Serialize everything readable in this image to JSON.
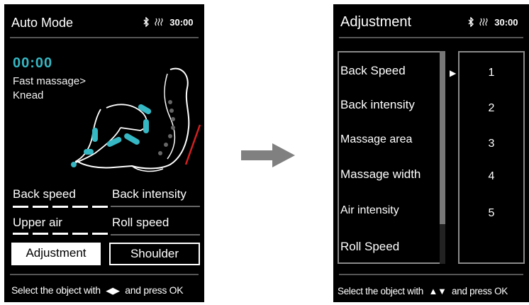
{
  "left_screen": {
    "title": "Auto Mode",
    "status": {
      "bluetooth_icon": "bluetooth-icon",
      "heat_icon": "heat-wave-icon",
      "time": "30:00"
    },
    "timer": "00:00",
    "program_line1": "Fast massage>",
    "program_line2": "Knead",
    "options": {
      "back_speed": "Back speed",
      "back_intensity": "Back intensity",
      "upper_air": "Upper air",
      "roll_speed": "Roll speed"
    },
    "buttons": {
      "adjustment": "Adjustment",
      "shoulder": "Shoulder"
    },
    "footer": {
      "before": "Select the object with",
      "symbol": "◀▶",
      "after": "and press OK"
    }
  },
  "right_screen": {
    "title": "Adjustment",
    "status": {
      "bluetooth_icon": "bluetooth-icon",
      "heat_icon": "heat-wave-icon",
      "time": "30:00"
    },
    "items": [
      "Back Speed",
      "Back intensity",
      "Massage area",
      "Massage width",
      "Air intensity",
      "Roll Speed"
    ],
    "values": [
      "1",
      "2",
      "3",
      "4",
      "5"
    ],
    "pointer": "▶",
    "footer": {
      "before": "Select the object with",
      "symbol": "▲▼",
      "after": "and press OK"
    }
  },
  "colors": {
    "accent": "#36b8c4",
    "warning": "#d42020",
    "screen_bg": "#000000",
    "arrow": "#808080"
  }
}
